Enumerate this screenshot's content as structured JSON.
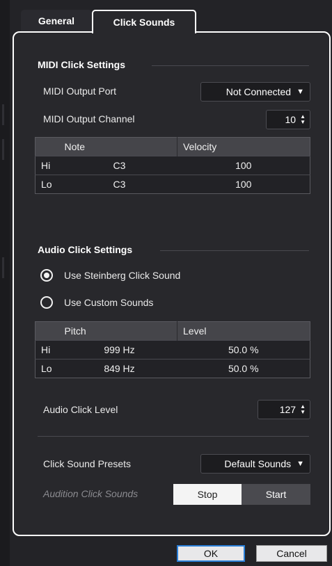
{
  "tabs": {
    "general": "General",
    "click_sounds": "Click Sounds"
  },
  "midi": {
    "title": "MIDI Click Settings",
    "output_port_label": "MIDI Output Port",
    "output_port_value": "Not Connected",
    "output_channel_label": "MIDI Output Channel",
    "output_channel_value": "10",
    "table": {
      "headers": [
        "",
        "Note",
        "Velocity"
      ],
      "rows": [
        {
          "label": "Hi",
          "note": "C3",
          "velocity": "100"
        },
        {
          "label": "Lo",
          "note": "C3",
          "velocity": "100"
        }
      ]
    }
  },
  "audio": {
    "title": "Audio Click Settings",
    "radio_steinberg": "Use Steinberg Click Sound",
    "radio_custom": "Use Custom Sounds",
    "table": {
      "headers": [
        "",
        "Pitch",
        "Level"
      ],
      "rows": [
        {
          "label": "Hi",
          "pitch": "999 Hz",
          "level": "50.0 %"
        },
        {
          "label": "Lo",
          "pitch": "849 Hz",
          "level": "50.0 %"
        }
      ]
    },
    "click_level_label": "Audio Click Level",
    "click_level_value": "127"
  },
  "presets": {
    "label": "Click Sound Presets",
    "value": "Default Sounds"
  },
  "audition": {
    "label": "Audition Click Sounds",
    "stop": "Stop",
    "start": "Start"
  },
  "footer": {
    "ok": "OK",
    "cancel": "Cancel"
  },
  "icons": {
    "dropdown": "caret-down-icon",
    "spinner": "up-down-arrows-icon",
    "radio_selected": "radio-selected-icon",
    "radio_unselected": "radio-unselected-icon"
  },
  "colors": {
    "background": "#232327",
    "panel": "#28282c",
    "table_header": "#45454a",
    "ok_border": "#2a7fd8"
  }
}
